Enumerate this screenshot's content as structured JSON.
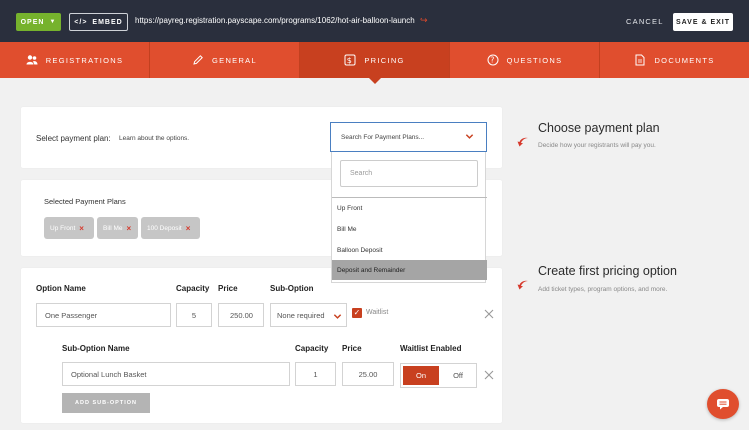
{
  "topbar": {
    "open_label": "OPEN",
    "embed_label": "EMBED",
    "url": "https://payreg.registration.payscape.com/programs/1062/hot-air-balloon-launch",
    "cancel_label": "CANCEL",
    "save_exit_label": "SAVE & EXIT"
  },
  "tabs": [
    {
      "label": "REGISTRATIONS",
      "icon": "users-icon"
    },
    {
      "label": "GENERAL",
      "icon": "pencil-icon"
    },
    {
      "label": "PRICING",
      "icon": "dollar-icon",
      "active": true
    },
    {
      "label": "QUESTIONS",
      "icon": "question-icon"
    },
    {
      "label": "DOCUMENTS",
      "icon": "document-icon"
    }
  ],
  "payment_plan": {
    "label": "Select payment plan:",
    "learn_text": "Learn about the options.",
    "select_placeholder": "Search For Payment Plans...",
    "dropdown_search_placeholder": "Search",
    "options": [
      "Up Front",
      "Bill Me",
      "Balloon Deposit",
      "Deposit and Remainder"
    ],
    "highlighted_option": "Deposit and Remainder"
  },
  "selected_plans": {
    "title": "Selected Payment Plans",
    "chips": [
      "Up Front",
      "Bill Me",
      "100 Deposit"
    ]
  },
  "aside": {
    "plan_title": "Choose payment plan",
    "plan_sub": "Decide how your registrants will pay you.",
    "pricing_title": "Create first pricing option",
    "pricing_sub": "Add ticket types, program options, and more."
  },
  "pricing_option": {
    "headers": {
      "option_name": "Option Name",
      "capacity": "Capacity",
      "price": "Price",
      "sub_option": "Sub-Option"
    },
    "option_name": "One Passenger",
    "capacity": "5",
    "price": "250.00",
    "sub_option": "None required",
    "waitlist_label": "Waitlist",
    "waitlist_checked": true
  },
  "sub_option": {
    "headers": {
      "name": "Sub-Option Name",
      "capacity": "Capacity",
      "price": "Price",
      "waitlist": "Waitlist Enabled"
    },
    "name": "Optional Lunch Basket",
    "capacity": "1",
    "price": "25.00",
    "on_label": "On",
    "off_label": "Off",
    "add_label": "ADD SUB-OPTION"
  },
  "colors": {
    "accent": "#e04e2e",
    "dark": "#2a2f3d",
    "green": "#76b22d"
  }
}
